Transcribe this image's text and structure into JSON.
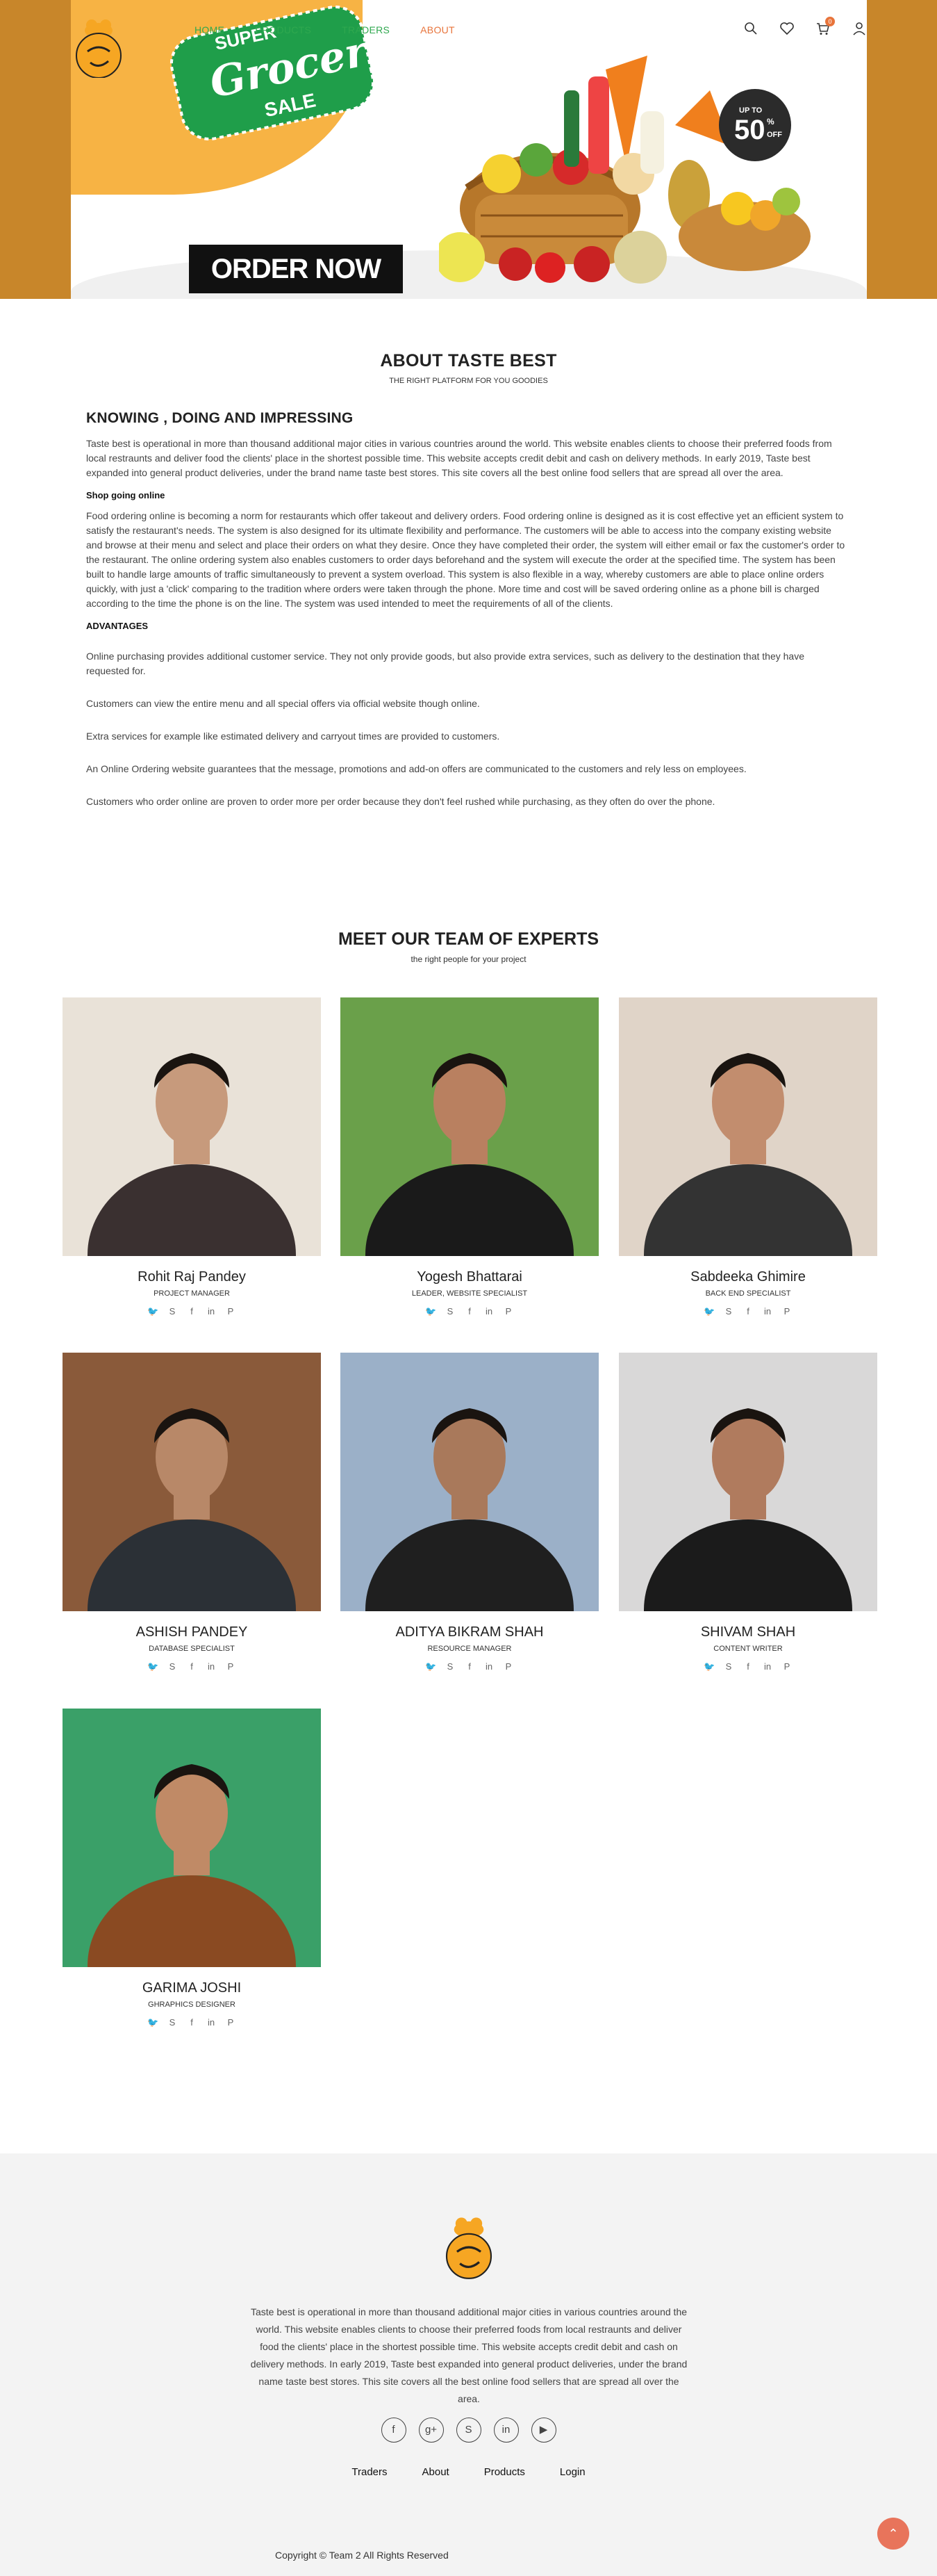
{
  "nav": {
    "links": [
      "HOME",
      "PRODUCTS",
      "TRADERS",
      "ABOUT"
    ],
    "active": "ABOUT",
    "cart_count": "0",
    "icons": [
      "search-icon",
      "heart-icon",
      "cart-icon",
      "user-icon"
    ]
  },
  "hero": {
    "sale_line1": "SUPER",
    "sale_line2": "Grocery",
    "sale_line3": "SALE",
    "offer_line1": "UP TO",
    "offer_value": "50",
    "offer_pct": "%",
    "offer_line2": "OFF",
    "order_button": "ORDER NOW"
  },
  "about": {
    "title": "ABOUT TASTE BEST",
    "subtitle": "THE RIGHT PLATFORM FOR YOU GOODIES",
    "heading": "KNOWING , DOING AND IMPRESSING",
    "intro": "Taste best is operational in more than thousand additional major cities in various countries around the world. This website enables clients to choose their preferred foods from local restraunts and deliver food the clients' place in the shortest possible time. This website accepts credit debit and cash on delivery methods. In early 2019, Taste best expanded into general product deliveries, under the brand name taste best stores. This site covers all the best online food sellers that are spread all over the area.",
    "shop_heading": "Shop going online",
    "shop_text": "Food ordering online is becoming a norm for restaurants which offer takeout and delivery orders. Food ordering online is designed as it is cost effective yet an efficient system to satisfy the restaurant's needs. The system is also designed for its ultimate flexibility and performance. The customers will be able to access into the company existing website and browse at their menu and select and place their orders on what they desire. Once they have completed their order, the system will either email or fax the customer's order to the restaurant. The online ordering system also enables customers to order days beforehand and the system will execute the order at the specified time. The system has been built to handle large amounts of traffic simultaneously to prevent a system overload. This system is also flexible in a way, whereby customers are able to place online orders quickly, with just a 'click' comparing to the tradition where orders were taken through the phone. More time and cost will be saved ordering online as a phone bill is charged according to the time the phone is on the line. The system was used intended to meet the requirements of all of the clients.",
    "adv_heading": "ADVANTAGES",
    "advantages": [
      "Online purchasing provides additional customer service. They not only provide goods, but also provide extra services, such as delivery to the destination that they have requested for.",
      "Customers can view the entire menu and all special offers via official website though online.",
      "Extra services for example like estimated delivery and carryout times are provided to customers.",
      "An Online Ordering website guarantees that the message, promotions and add-on offers are communicated to the customers and rely less on employees.",
      "Customers who order online are proven to order more per order because they don't feel rushed while purchasing, as they often do over the phone."
    ]
  },
  "team": {
    "title": "MEET OUR TEAM OF EXPERTS",
    "subtitle": "the right people for your project",
    "members": [
      {
        "name": "Rohit Raj Pandey",
        "role": "PROJECT MANAGER"
      },
      {
        "name": "Yogesh Bhattarai",
        "role": "LEADER, WEBSITE SPECIALIST"
      },
      {
        "name": "Sabdeeka Ghimire",
        "role": "BACK END SPECIALIST"
      },
      {
        "name": "ASHISH PANDEY",
        "role": "DATABASE SPECIALIST"
      },
      {
        "name": "ADITYA BIKRAM SHAH",
        "role": "RESOURCE MANAGER"
      },
      {
        "name": "SHIVAM SHAH",
        "role": "CONTENT WRITER"
      },
      {
        "name": "GARIMA JOSHI",
        "role": "GHRAPHICS DESIGNER"
      }
    ],
    "social_icons": [
      "twitter-icon",
      "skype-icon",
      "facebook-icon",
      "linkedin-icon",
      "pinterest-icon"
    ]
  },
  "footer": {
    "text": "Taste best is operational in more than thousand additional major cities in various countries around the world. This website enables clients to choose their preferred foods from local restraunts and deliver food the clients' place in the shortest possible time. This website accepts credit debit and cash on delivery methods. In early 2019, Taste best expanded into general product deliveries, under the brand name taste best stores. This site covers all the best online food sellers that are spread all over the area.",
    "social_icons": [
      "facebook-icon",
      "google-plus-icon",
      "skype-icon",
      "linkedin-icon",
      "youtube-icon"
    ],
    "links": [
      "Traders",
      "About",
      "Products",
      "Login"
    ],
    "copyright": "Copyright © Team 2 All Rights Reserved"
  },
  "colors": {
    "accent": "#e8743b",
    "nav_green": "#2fa84f",
    "hero_side": "#c8862a"
  }
}
